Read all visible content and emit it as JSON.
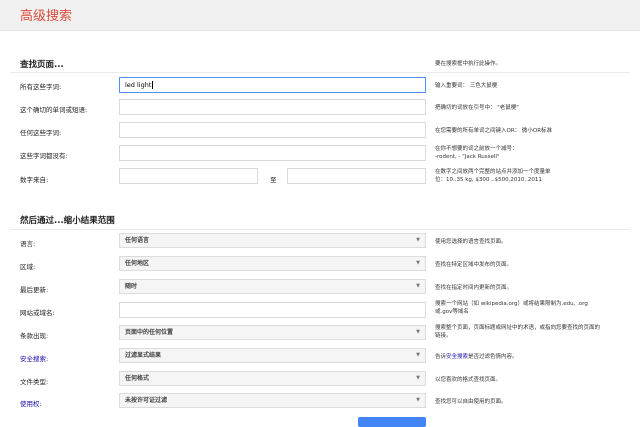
{
  "header": {
    "title": "高级搜索"
  },
  "section1": {
    "title": "查找页面...",
    "header_hint": "要在搜索框中执行此操作。",
    "rows": [
      {
        "label": "所有这些字词:",
        "value": "led light",
        "hint": "输入重要词：  三色大鼠梗"
      },
      {
        "label": "这个确切的单词或短语:",
        "value": "",
        "hint": "把确切的词放在引号中：  \"老鼠梗\""
      },
      {
        "label": "任何这些字词:",
        "value": "",
        "hint": "在您需要的所有单词之间键入OR：  微小OR标准"
      },
      {
        "label": "这些字词都没有:",
        "value": "",
        "hint_lines": [
          "在你不想要的词之前放一个减号：",
          "-rodent,  - \"Jack Russell\""
        ]
      },
      {
        "label": "数字来自:",
        "from": "",
        "to_label": "至",
        "to": "",
        "hint_lines": [
          "在数字之间放两个完整的站点并添加一个度量单",
          "位：10..35 kg, $300 ..$500,2010..2011"
        ]
      }
    ]
  },
  "section2": {
    "title": "然后通过...缩小结果范围",
    "rows": [
      {
        "label": "语言:",
        "value": "任何语言",
        "hint": "使用您选择的语言查找页面。"
      },
      {
        "label": "区域:",
        "value": "任何地区",
        "hint": "查找在特定区域中发布的页面。"
      },
      {
        "label": "最后更新:",
        "value": "随时",
        "hint": "查找在指定时间内更新的页面。"
      },
      {
        "label": "网站或域名:",
        "value": "",
        "hint_lines": [
          "搜索一个网站（如 wikipedia.org）或将结果限制为.edu, .org",
          "或.gov等域名"
        ]
      },
      {
        "label": "条款出现:",
        "value": "页面中的任何位置",
        "hint_lines": [
          "搜索整个页面，页面标题或网址中的术语，或指向您要查找的页面的",
          "链接。"
        ]
      },
      {
        "label": "安全搜索:",
        "value": "过滤显式结果",
        "hint_pre": "告诉",
        "hint_link": "安全搜索",
        "hint_post": "是否过滤色情内容。"
      },
      {
        "label": "文件类型:",
        "value": "任何格式",
        "hint": "以您喜欢的格式查找页面。"
      },
      {
        "label": "使用权:",
        "value": "未按许可证过滤",
        "hint": "查找您可以自由使用的页面。"
      }
    ]
  }
}
